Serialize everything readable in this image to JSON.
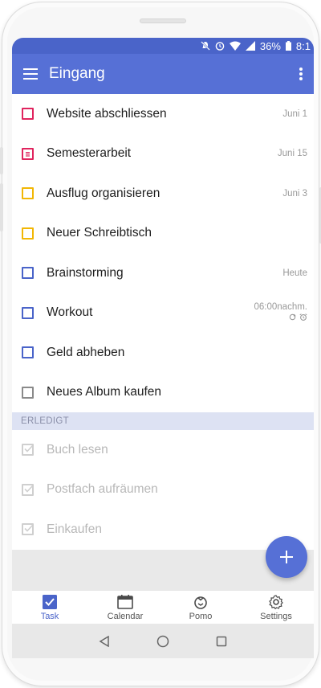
{
  "status_bar": {
    "battery": "36%",
    "time": "8:1"
  },
  "app_bar": {
    "title": "Eingang"
  },
  "tasks": [
    {
      "title": "Website abschliessen",
      "date": "Juni 1",
      "color": "#e0245e"
    },
    {
      "title": "Semesterarbeit",
      "date": "Juni 15",
      "color": "#e0245e",
      "icon": "notes-checkbox-icon"
    },
    {
      "title": "Ausflug organisieren",
      "date": "Juni 3",
      "color": "#f2b705"
    },
    {
      "title": "Neuer Schreibtisch",
      "date": "",
      "color": "#f2b705"
    },
    {
      "title": "Brainstorming",
      "date": "Heute",
      "color": "#4a64c9"
    },
    {
      "title": "Workout",
      "date": "06:00nachm.",
      "color": "#4a64c9",
      "sub_icons": "repeat-icon alarm-icon"
    },
    {
      "title": "Geld abheben",
      "date": "",
      "color": "#4a64c9"
    },
    {
      "title": "Neues Album kaufen",
      "date": "",
      "color": "#8a8a8a"
    }
  ],
  "completed_section": {
    "label": "ERLEDIGT",
    "items": [
      {
        "title": "Buch lesen"
      },
      {
        "title": "Postfach aufräumen"
      },
      {
        "title": "Einkaufen"
      }
    ]
  },
  "bottom_nav": [
    {
      "label": "Task",
      "icon": "task-check-icon",
      "active": true
    },
    {
      "label": "Calendar",
      "icon": "calendar-icon",
      "active": false
    },
    {
      "label": "Pomo",
      "icon": "pomo-timer-icon",
      "active": false
    },
    {
      "label": "Settings",
      "icon": "gear-icon",
      "active": false
    }
  ],
  "colors": {
    "primary": "#5670d6",
    "status_bar": "#4a64c9",
    "section_bg": "#dde2f3"
  }
}
